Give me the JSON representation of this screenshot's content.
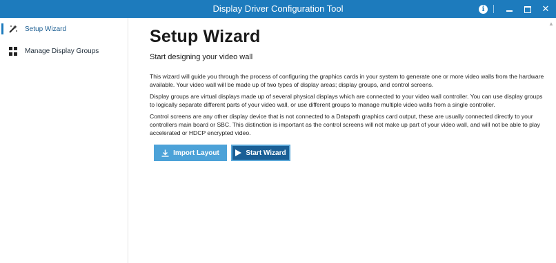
{
  "window": {
    "title": "Display Driver Configuration Tool",
    "controls": {
      "info": "i",
      "close": "✕"
    }
  },
  "sidebar": {
    "items": [
      {
        "label": "Setup Wizard",
        "icon": "wand-icon",
        "active": true
      },
      {
        "label": "Manage Display Groups",
        "icon": "grid-icon",
        "active": false
      }
    ]
  },
  "main": {
    "title": "Setup Wizard",
    "subtitle": "Start designing your video wall",
    "paragraphs": [
      "This wizard will guide you through the process of configuring the graphics cards in your system to generate one or more video walls from the hardware available. Your video wall will be made up of two types of display areas; display groups, and control screens.",
      "Display groups are virtual displays made up of several physical displays which are connected to your video wall controller. You can use display groups to logically separate different parts of your video wall, or use different groups to manage multiple video walls from a single controller.",
      "Control screens are any other display device that is not connected to a Datapath graphics card output, these are usually connected directly to your controllers main board or SBC. This distinction is important as the control screens will not make up part of your video wall, and will not be able to play accelerated or HDCP encrypted video."
    ],
    "buttons": {
      "import": "Import Layout",
      "start": "Start Wizard"
    }
  },
  "colors": {
    "titlebar": "#1d7bbd",
    "import_button": "#4ca2d8",
    "start_button": "#1a5f96"
  }
}
